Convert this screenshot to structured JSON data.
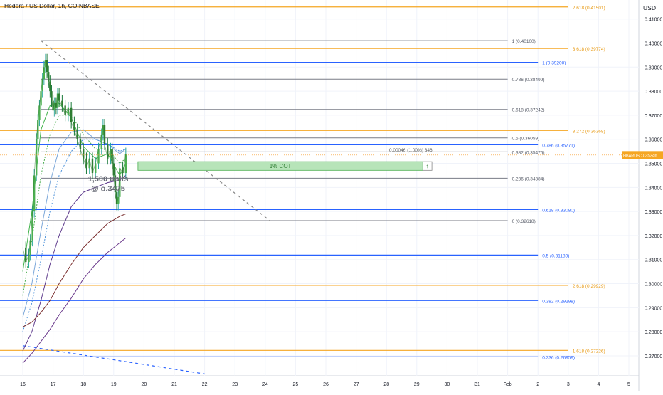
{
  "title": "Hedera / US Dollar, 1h, COINBASE",
  "chart_data": {
    "type": "line",
    "symbol": "HBARUSD",
    "currency": "USD",
    "y_ticks": [
      "0.41000",
      "0.40000",
      "0.39000",
      "0.38000",
      "0.37000",
      "0.36000",
      "0.35000",
      "0.34000",
      "0.33000",
      "0.32000",
      "0.31000",
      "0.30000",
      "0.29000",
      "0.28000",
      "0.27000"
    ],
    "ylim": [
      0.2617,
      0.4179
    ],
    "x_ticks": [
      "16",
      "17",
      "18",
      "19",
      "20",
      "21",
      "22",
      "23",
      "24",
      "25",
      "26",
      "27",
      "28",
      "29",
      "30",
      "31",
      "Feb",
      "2",
      "3",
      "4",
      "5"
    ],
    "x_day_start": 16,
    "grid": true,
    "current_price": 0.35346,
    "current_price_label": "HBARUSD",
    "current_price_value": "0.35346",
    "fib_retracement": [
      {
        "label": "1 (0.40100)",
        "value": 0.401
      },
      {
        "label": "0.786 (0.38499)",
        "value": 0.38499
      },
      {
        "label": "0.618 (0.37242)",
        "value": 0.37242
      },
      {
        "label": "0.5 (0.36059)",
        "value": 0.36059
      },
      {
        "label": "0.382 (0.35476)",
        "value": 0.35476
      },
      {
        "label": "0.236 (0.34384)",
        "value": 0.34384
      },
      {
        "label": "0 (0.32618)",
        "value": 0.32618
      }
    ],
    "blue_levels": [
      {
        "label": "1 (0.39200)",
        "value": 0.392
      },
      {
        "label": "0.786 (0.35771)",
        "value": 0.35771
      },
      {
        "label": "0.618 (0.33080)",
        "value": 0.3308
      },
      {
        "label": "0.5 (0.31189)",
        "value": 0.31189
      },
      {
        "label": "0.382 (0.29298)",
        "value": 0.29298
      },
      {
        "label": "0.236 (0.26959)",
        "value": 0.26959
      }
    ],
    "orange_levels": [
      {
        "label": "2.618 (0.41501)",
        "value": 0.41501
      },
      {
        "label": "3.618 (0.39774)",
        "value": 0.39774
      },
      {
        "label": "3.272 (0.36368)",
        "value": 0.36368
      },
      {
        "label": "2.618 (0.29929)",
        "value": 0.29929
      },
      {
        "label": "1.618 (0.27226)",
        "value": 0.27226
      }
    ],
    "position_box": {
      "label": "1% COT",
      "top": 0.3507,
      "bottom": 0.3471,
      "info": "0.00046 (1.00%) 346"
    },
    "annotation": "1,500 units\n@ o.3475",
    "price_path": [
      [
        16.0,
        0.315
      ],
      [
        16.1,
        0.309
      ],
      [
        16.2,
        0.312
      ],
      [
        16.25,
        0.318
      ],
      [
        16.32,
        0.33
      ],
      [
        16.38,
        0.345
      ],
      [
        16.45,
        0.36
      ],
      [
        16.5,
        0.368
      ],
      [
        16.55,
        0.374
      ],
      [
        16.6,
        0.38
      ],
      [
        16.65,
        0.385
      ],
      [
        16.7,
        0.39
      ],
      [
        16.75,
        0.393
      ],
      [
        16.8,
        0.388
      ],
      [
        16.85,
        0.384
      ],
      [
        16.9,
        0.38
      ],
      [
        16.95,
        0.376
      ],
      [
        17.0,
        0.372
      ],
      [
        17.05,
        0.375
      ],
      [
        17.1,
        0.373
      ],
      [
        17.15,
        0.379
      ],
      [
        17.2,
        0.376
      ],
      [
        17.3,
        0.374
      ],
      [
        17.4,
        0.37
      ],
      [
        17.5,
        0.373
      ],
      [
        17.6,
        0.367
      ],
      [
        17.7,
        0.364
      ],
      [
        17.8,
        0.36
      ],
      [
        17.9,
        0.356
      ],
      [
        18.0,
        0.352
      ],
      [
        18.1,
        0.348
      ],
      [
        18.2,
        0.352
      ],
      [
        18.3,
        0.346
      ],
      [
        18.4,
        0.35
      ],
      [
        18.5,
        0.356
      ],
      [
        18.6,
        0.362
      ],
      [
        18.65,
        0.366
      ],
      [
        18.7,
        0.358
      ],
      [
        18.8,
        0.352
      ],
      [
        18.9,
        0.356
      ],
      [
        18.95,
        0.35
      ],
      [
        19.0,
        0.345
      ],
      [
        19.05,
        0.338
      ],
      [
        19.1,
        0.333
      ],
      [
        19.15,
        0.336
      ],
      [
        19.2,
        0.348
      ],
      [
        19.3,
        0.346
      ],
      [
        19.4,
        0.354
      ]
    ],
    "ma_lines": [
      {
        "name": "",
        "color": "#3FB24A",
        "dashed": false,
        "points": [
          [
            16.0,
            0.305
          ],
          [
            16.3,
            0.33
          ],
          [
            16.6,
            0.364
          ],
          [
            16.9,
            0.374
          ],
          [
            17.2,
            0.375
          ],
          [
            17.6,
            0.369
          ],
          [
            18.0,
            0.357
          ],
          [
            18.4,
            0.352
          ],
          [
            18.8,
            0.354
          ],
          [
            19.2,
            0.345
          ],
          [
            19.4,
            0.35
          ]
        ]
      },
      {
        "name": "",
        "color": "#4CAF50",
        "dashed": true,
        "points": [
          [
            16.0,
            0.295
          ],
          [
            16.3,
            0.318
          ],
          [
            16.6,
            0.345
          ],
          [
            16.9,
            0.362
          ],
          [
            17.2,
            0.37
          ],
          [
            17.6,
            0.37
          ],
          [
            18.0,
            0.362
          ],
          [
            18.4,
            0.356
          ],
          [
            18.8,
            0.356
          ],
          [
            19.2,
            0.35
          ],
          [
            19.4,
            0.352
          ]
        ]
      },
      {
        "name": "",
        "color": "#7BA7D9",
        "dashed": false,
        "points": [
          [
            16.0,
            0.286
          ],
          [
            16.3,
            0.3
          ],
          [
            16.6,
            0.322
          ],
          [
            16.9,
            0.342
          ],
          [
            17.2,
            0.356
          ],
          [
            17.6,
            0.363
          ],
          [
            18.0,
            0.364
          ],
          [
            18.4,
            0.36
          ],
          [
            18.8,
            0.358
          ],
          [
            19.2,
            0.354
          ],
          [
            19.4,
            0.356
          ]
        ]
      },
      {
        "name": "",
        "color": "#4A90D9",
        "dashed": true,
        "points": [
          [
            16.0,
            0.28
          ],
          [
            16.3,
            0.292
          ],
          [
            16.6,
            0.31
          ],
          [
            16.9,
            0.33
          ],
          [
            17.2,
            0.345
          ],
          [
            17.6,
            0.355
          ],
          [
            18.0,
            0.36
          ],
          [
            18.4,
            0.36
          ],
          [
            18.8,
            0.358
          ],
          [
            19.2,
            0.355
          ],
          [
            19.4,
            0.356
          ]
        ]
      },
      {
        "name": "",
        "color": "#5E3A8C",
        "dashed": false,
        "points": [
          [
            16.0,
            0.272
          ],
          [
            16.3,
            0.28
          ],
          [
            16.6,
            0.293
          ],
          [
            16.9,
            0.308
          ],
          [
            17.2,
            0.32
          ],
          [
            17.6,
            0.332
          ],
          [
            18.0,
            0.338
          ],
          [
            18.4,
            0.34
          ],
          [
            18.8,
            0.342
          ],
          [
            19.2,
            0.343
          ],
          [
            19.4,
            0.345
          ]
        ]
      },
      {
        "name": "",
        "color": "#7A2E2E",
        "dashed": false,
        "points": [
          [
            16.0,
            0.282
          ],
          [
            16.3,
            0.284
          ],
          [
            16.6,
            0.288
          ],
          [
            16.9,
            0.293
          ],
          [
            17.2,
            0.3
          ],
          [
            17.6,
            0.308
          ],
          [
            18.0,
            0.315
          ],
          [
            18.4,
            0.32
          ],
          [
            18.8,
            0.325
          ],
          [
            19.2,
            0.328
          ],
          [
            19.4,
            0.329
          ]
        ]
      },
      {
        "name": "",
        "color": "#6B3A8C",
        "dashed": false,
        "points": [
          [
            16.0,
            0.267
          ],
          [
            16.3,
            0.271
          ],
          [
            16.6,
            0.276
          ],
          [
            16.9,
            0.281
          ],
          [
            17.2,
            0.287
          ],
          [
            17.6,
            0.294
          ],
          [
            18.0,
            0.302
          ],
          [
            18.4,
            0.308
          ],
          [
            18.8,
            0.313
          ],
          [
            19.2,
            0.317
          ],
          [
            19.4,
            0.319
          ]
        ]
      }
    ],
    "trendlines": [
      {
        "color": "#888888",
        "dashed": true,
        "points": [
          [
            16.6,
            0.401
          ],
          [
            24.15,
            0.32618
          ]
        ]
      },
      {
        "color": "#2962FF",
        "dashed": true,
        "points": [
          [
            16.0,
            0.2742
          ],
          [
            22.0,
            0.2625
          ]
        ]
      }
    ]
  }
}
